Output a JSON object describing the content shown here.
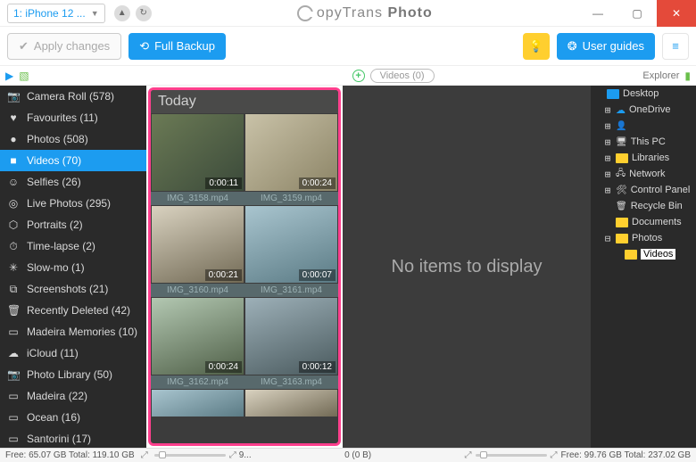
{
  "title": {
    "device": "1: iPhone 12 ...",
    "brand_left": "opyTrans",
    "brand_right": " Photo"
  },
  "toolbar": {
    "apply": "Apply changes",
    "backup": "Full Backup",
    "guides": "User guides"
  },
  "iconrow": {
    "center_pill": "Videos (0)",
    "explorer": "Explorer"
  },
  "sidebar": [
    {
      "icon": "📷",
      "label": "Camera Roll (578)"
    },
    {
      "icon": "♥",
      "label": "Favourites (11)"
    },
    {
      "icon": "●",
      "label": "Photos (508)"
    },
    {
      "icon": "■",
      "label": "Videos (70)",
      "active": true
    },
    {
      "icon": "☺",
      "label": "Selfies (26)"
    },
    {
      "icon": "◎",
      "label": "Live Photos (295)"
    },
    {
      "icon": "⬡",
      "label": "Portraits (2)"
    },
    {
      "icon": "⏱",
      "label": "Time-lapse (2)"
    },
    {
      "icon": "✳",
      "label": "Slow-mo (1)"
    },
    {
      "icon": "⧉",
      "label": "Screenshots (21)"
    },
    {
      "icon": "🗑",
      "label": "Recently Deleted (42)"
    },
    {
      "icon": "▭",
      "label": "Madeira Memories (10)"
    },
    {
      "icon": "☁",
      "label": "iCloud (11)"
    },
    {
      "icon": "📷",
      "label": "Photo Library (50)"
    },
    {
      "icon": "▭",
      "label": "Madeira (22)"
    },
    {
      "icon": "▭",
      "label": "Ocean (16)"
    },
    {
      "icon": "▭",
      "label": "Santorini (17)"
    }
  ],
  "grid": {
    "header": "Today",
    "rows": [
      {
        "thumbs": [
          {
            "cls": "a",
            "dur": "0:00:11"
          },
          {
            "cls": "b",
            "dur": "0:00:24"
          }
        ],
        "files": [
          "IMG_3158.mp4",
          "IMG_3159.mp4"
        ]
      },
      {
        "thumbs": [
          {
            "cls": "c",
            "dur": "0:00:21"
          },
          {
            "cls": "d",
            "dur": "0:00:07"
          }
        ],
        "files": [
          "IMG_3160.mp4",
          "IMG_3161.mp4"
        ]
      },
      {
        "thumbs": [
          {
            "cls": "e",
            "dur": "0:00:24"
          },
          {
            "cls": "f",
            "dur": "0:00:12"
          }
        ],
        "files": [
          "IMG_3162.mp4",
          "IMG_3163.mp4"
        ]
      }
    ]
  },
  "center": {
    "empty": "No items to display"
  },
  "explorer": [
    {
      "expand": "",
      "color": "#1c9cf0",
      "label": "Desktop",
      "indent": 0
    },
    {
      "expand": "⊞",
      "color": "#1c9cf0",
      "label": "OneDrive",
      "indent": 1,
      "cloud": true
    },
    {
      "expand": "⊞",
      "color": "#8a8a8a",
      "label": "",
      "indent": 1,
      "tinyicon": "👤"
    },
    {
      "expand": "⊞",
      "color": "#1c9cf0",
      "label": "This PC",
      "indent": 1,
      "tinyicon": "🖥"
    },
    {
      "expand": "⊞",
      "color": "#ffcf2f",
      "label": "Libraries",
      "indent": 1
    },
    {
      "expand": "⊞",
      "color": "#1c9cf0",
      "label": "Network",
      "indent": 1,
      "tinyicon": "🖧"
    },
    {
      "expand": "⊞",
      "color": "#1c9cf0",
      "label": "Control Panel",
      "indent": 1,
      "tinyicon": "🛠"
    },
    {
      "expand": "",
      "color": "#8a8a8a",
      "label": "Recycle Bin",
      "indent": 1,
      "tinyicon": "🗑"
    },
    {
      "expand": "",
      "color": "#ffcf2f",
      "label": "Documents",
      "indent": 1
    },
    {
      "expand": "⊟",
      "color": "#ffcf2f",
      "label": "Photos",
      "indent": 1
    },
    {
      "expand": "",
      "color": "#ffcf2f",
      "label": "Videos",
      "indent": 2,
      "selected": true
    }
  ],
  "status": {
    "left": "Free: 65.07 GB Total: 119.10 GB",
    "mid_count": "9...",
    "center": "0 (0 B)",
    "right": "Free: 99.76 GB Total: 237.02 GB"
  }
}
